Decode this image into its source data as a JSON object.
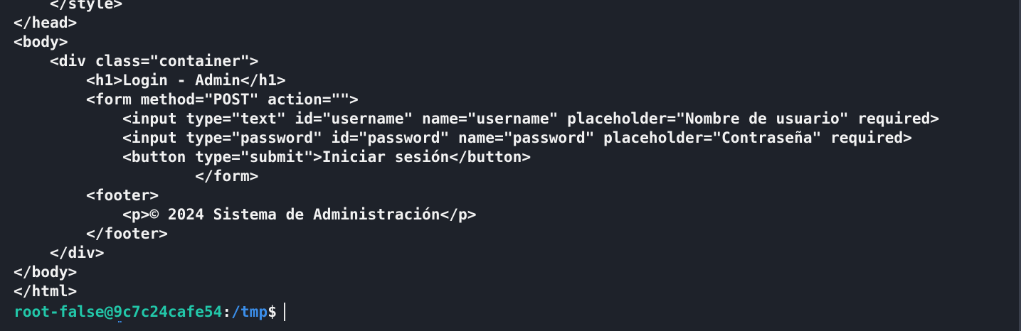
{
  "terminal": {
    "lines": [
      "    </style>",
      "</head>",
      "<body>",
      "    <div class=\"container\">",
      "        <h1>Login - Admin</h1>",
      "        <form method=\"POST\" action=\"\">",
      "            <input type=\"text\" id=\"username\" name=\"username\" placeholder=\"Nombre de usuario\" required>",
      "            <input type=\"password\" id=\"password\" name=\"password\" placeholder=\"Contraseña\" required>",
      "            <button type=\"submit\">Iniciar sesión</button>",
      "                    </form>",
      "        <footer>",
      "            <p>© 2024 Sistema de Administración</p>",
      "        </footer>",
      "    </div>",
      "</body>",
      "</html>"
    ],
    "prompt": {
      "user_host": "root-false@9c7c24cafe54",
      "separator": ":",
      "path": "/tmp",
      "symbol": "$"
    }
  },
  "colors": {
    "background": "#1e222a",
    "text": "#f2f2f2",
    "user_host": "#22c7a9",
    "path": "#3b8eea"
  }
}
